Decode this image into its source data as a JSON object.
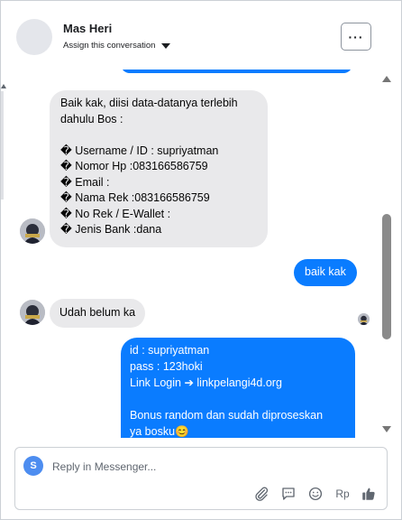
{
  "header": {
    "contact_name": "Mas Heri",
    "assign_label": "Assign this conversation",
    "more_label": "···"
  },
  "messages": {
    "data_request_lines": [
      "Baik kak, diisi data-datanya terlebih",
      "dahulu Bos :",
      "",
      "� Username / ID : supriyatman",
      "� Nomor Hp :083166586759",
      "� Email :",
      "� Nama Rek :083166586759",
      "� No Rek / E-Wallet :",
      "� Jenis Bank :dana"
    ],
    "reply_baik": "baik kak",
    "udah_belum": "Udah belum ka",
    "account_lines": [
      "id : supriyatman",
      "pass : 123hoki",
      "Link Login ➔ linkpelangi4d.org",
      "",
      "Bonus random dan sudah diproseskan",
      "ya bosku😊"
    ]
  },
  "composer": {
    "avatar_initial": "S",
    "placeholder": "Reply in Messenger...",
    "currency_label": "Rp"
  },
  "colors": {
    "outgoing_bubble": "#0a7cff",
    "incoming_bubble": "#e9e9eb",
    "composer_avatar": "#4d8df0"
  },
  "icons": [
    "caret-down-icon",
    "more-icon",
    "attachment-icon",
    "saved-replies-icon",
    "emoji-icon",
    "thumbs-up-icon"
  ]
}
